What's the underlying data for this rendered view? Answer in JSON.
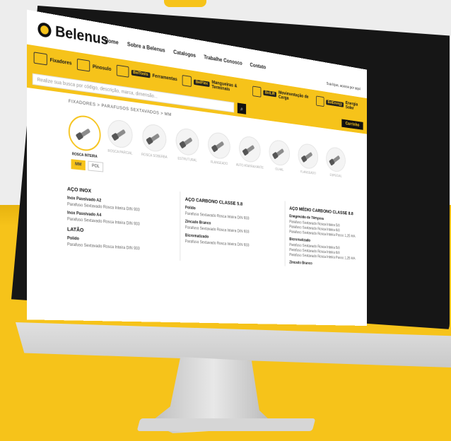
{
  "header": {
    "brand": "Belenus",
    "nav": [
      "Home",
      "Sobre a Belenus",
      "Catalogos",
      "Trabalhe Conosco",
      "Contato"
    ],
    "user_info": "Sua lojas, acesse por aqui"
  },
  "categories": [
    {
      "label": "Fixadores",
      "badge": ""
    },
    {
      "label": "Pinosulo",
      "badge": ""
    },
    {
      "label": "Ferramentas",
      "badge": "BelTools"
    },
    {
      "label": "Mangueiras & Terminais",
      "badge": "BelFlex"
    },
    {
      "label": "Movimentação de Carga",
      "badge": "BelLift"
    },
    {
      "label": "Energia Solar",
      "badge": "BelEnergy"
    }
  ],
  "search": {
    "placeholder": "Realize sua busca por código, descrição, marca, dimensão...",
    "cart_label": "Carrinho"
  },
  "breadcrumb": "FIXADORES  >  PARAFUSOS SEXTAVADOS  >  MM",
  "thumbnails": [
    {
      "label": "ROSCA INTEIRA",
      "active": true
    },
    {
      "label": "ROSCA PARCIAL",
      "active": false
    },
    {
      "label": "ROSCA SOBERBA",
      "active": false
    },
    {
      "label": "ESTRUTURAL",
      "active": false
    },
    {
      "label": "FLANGEADO",
      "active": false
    },
    {
      "label": "AUTO ATARRAXANTE",
      "active": false
    },
    {
      "label": "OLHAL",
      "active": false
    },
    {
      "label": "FLANGEADO",
      "active": false
    },
    {
      "label": "ESPECIAL",
      "active": false
    }
  ],
  "units": [
    "MM",
    "POL"
  ],
  "columns": [
    {
      "sections": [
        {
          "title": "AÇO INOX",
          "groups": [
            {
              "name": "Inox Passivado A2",
              "items": [
                "Parafuso Sextavado Rosca Inteira DIN 933"
              ]
            },
            {
              "name": "Inox Passivado A4",
              "items": [
                "Parafuso Sextavado Rosca Inteira DIN 933"
              ]
            }
          ]
        },
        {
          "title": "LATÃO",
          "groups": [
            {
              "name": "Polido",
              "items": [
                "Parafuso Sextavado Rosca Inteira DIN 933"
              ]
            }
          ]
        }
      ]
    },
    {
      "sections": [
        {
          "title": "AÇO CARBONO CLASSE 5.8",
          "groups": [
            {
              "name": "Polido",
              "items": [
                "Parafuso Sextavado Rosca Inteira DIN 933"
              ]
            },
            {
              "name": "Zincado Branco",
              "items": [
                "Parafuso Sextavado Rosca Inteira DIN 933"
              ]
            },
            {
              "name": "Bicromatizado",
              "items": [
                "Parafuso Sextavado Rosca Inteira DIN 933"
              ]
            }
          ]
        }
      ]
    },
    {
      "sections": [
        {
          "title": "AÇO MÉDIO CARBONO CLASSE 8.8",
          "groups": [
            {
              "name": "Enegrecido de Têmpera",
              "items": [
                "Parafuso Sextavado Rosca Inteira 5/8",
                "Parafuso Sextavado Rosca Inteira 6/8",
                "Parafuso Sextavado Rosca Inteira Passo 1,25 MA"
              ]
            },
            {
              "name": "Bicromatizado",
              "items": [
                "Parafuso Sextavado Rosca Inteira 5/8",
                "Parafuso Sextavado Rosca Inteira 6/8",
                "Parafuso Sextavado Rosca Inteira Passo 1,25 MA"
              ]
            },
            {
              "name": "Zincado Branco",
              "items": []
            }
          ]
        }
      ]
    }
  ],
  "colors": {
    "brand_yellow": "#f6c31a",
    "dark": "#111111"
  }
}
